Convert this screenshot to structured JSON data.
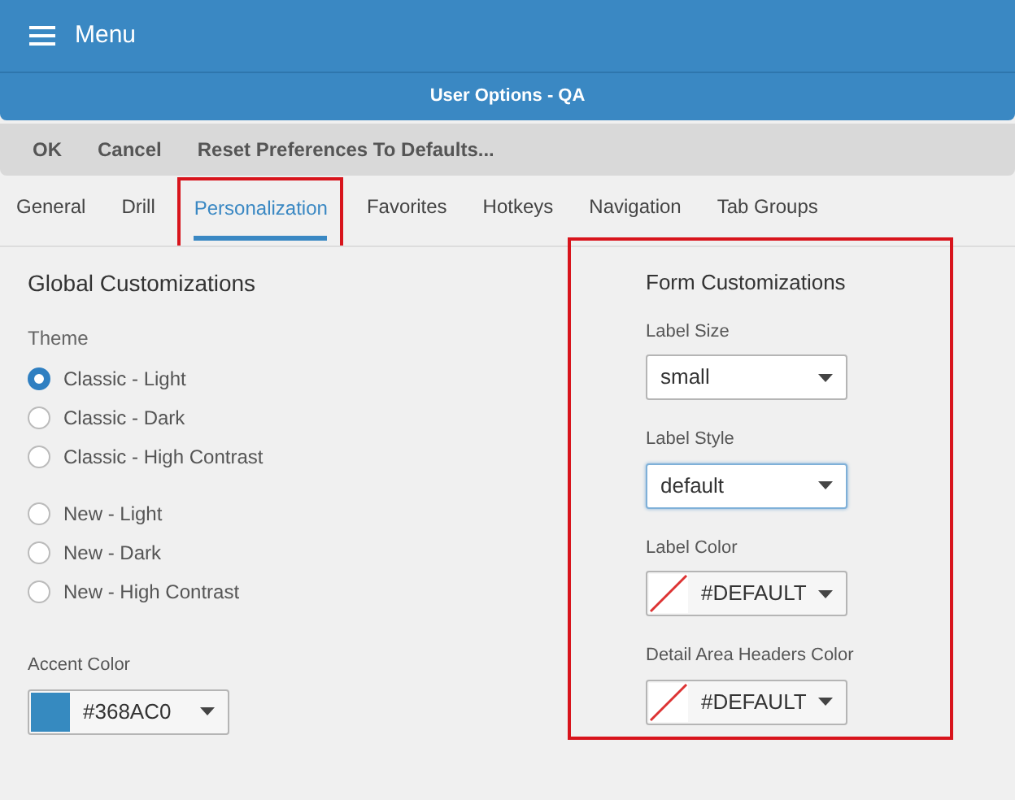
{
  "header": {
    "menu_label": "Menu"
  },
  "dialog": {
    "title": "User Options - QA"
  },
  "toolbar": [
    "OK",
    "Cancel",
    "Reset Preferences To Defaults..."
  ],
  "tabs": [
    {
      "label": "General",
      "selected": false,
      "highlighted": false
    },
    {
      "label": "Drill",
      "selected": false,
      "highlighted": false
    },
    {
      "label": "Personalization",
      "selected": true,
      "highlighted": true
    },
    {
      "label": "Favorites",
      "selected": false,
      "highlighted": false
    },
    {
      "label": "Hotkeys",
      "selected": false,
      "highlighted": false
    },
    {
      "label": "Navigation",
      "selected": false,
      "highlighted": false
    },
    {
      "label": "Tab Groups",
      "selected": false,
      "highlighted": false
    }
  ],
  "global": {
    "title": "Global Customizations",
    "theme_label": "Theme",
    "theme_groups": [
      [
        {
          "label": "Classic - Light",
          "selected": true
        },
        {
          "label": "Classic - Dark",
          "selected": false
        },
        {
          "label": "Classic - High Contrast",
          "selected": false
        }
      ],
      [
        {
          "label": "New - Light",
          "selected": false
        },
        {
          "label": "New - Dark",
          "selected": false
        },
        {
          "label": "New - High Contrast",
          "selected": false
        }
      ]
    ],
    "accent": {
      "label": "Accent Color",
      "value": "#368AC0",
      "color": "#368ac0"
    }
  },
  "form": {
    "title": "Form Customizations",
    "highlighted": true,
    "fields": [
      {
        "kind": "select",
        "label": "Label Size",
        "value": "small",
        "focused": false
      },
      {
        "kind": "select",
        "label": "Label Style",
        "value": "default",
        "focused": true
      },
      {
        "kind": "color",
        "label": "Label Color",
        "value": "#DEFAULT",
        "focused": false
      },
      {
        "kind": "color",
        "label": "Detail Area Headers Color",
        "value": "#DEFAULT",
        "focused": false
      }
    ]
  }
}
